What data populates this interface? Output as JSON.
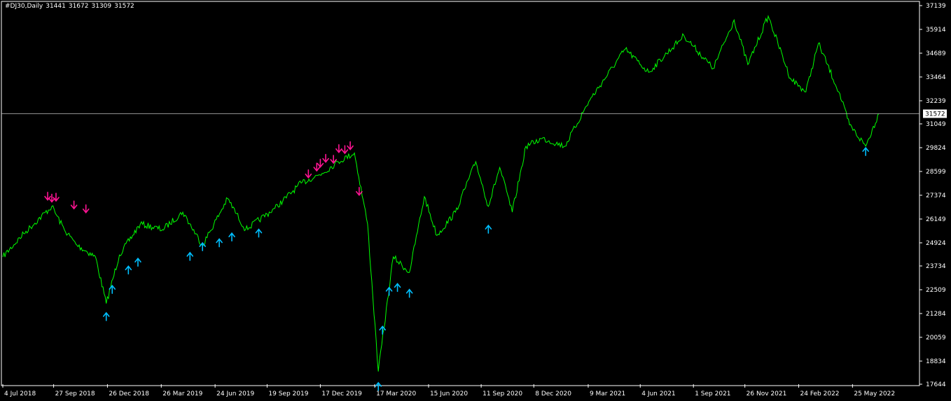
{
  "header": {
    "symbol": "#DJ30,Daily",
    "open": "31441",
    "high": "31672",
    "low": "31309",
    "close": "31572"
  },
  "colors": {
    "background": "#000000",
    "frame": "#ffffff",
    "price_line": "#00ff00",
    "sell_arrow": "#ff1493",
    "buy_arrow": "#00bfff",
    "current_price_line": "#c0c0c0"
  },
  "chart_data": {
    "type": "line",
    "title": "",
    "series": [
      {
        "name": "",
        "x": [
          "2018-07-04",
          "2018-08-08",
          "2018-09-24",
          "2018-10-15",
          "2018-11-05",
          "2018-12-06",
          "2018-12-24",
          "2019-01-15",
          "2019-02-19",
          "2019-03-28",
          "2019-05-01",
          "2019-06-03",
          "2019-07-15",
          "2019-08-14",
          "2019-10-02",
          "2019-11-15",
          "2019-12-20",
          "2020-01-16",
          "2020-02-12",
          "2020-03-05",
          "2020-03-23",
          "2020-04-17",
          "2020-05-14",
          "2020-06-08",
          "2020-06-29",
          "2020-07-30",
          "2020-09-02",
          "2020-09-23",
          "2020-10-12",
          "2020-11-02",
          "2020-11-25",
          "2020-12-22",
          "2021-01-29",
          "2021-03-10",
          "2021-05-10",
          "2021-06-18",
          "2021-08-16",
          "2021-10-04",
          "2021-11-08",
          "2021-12-01",
          "2022-01-04",
          "2022-02-10",
          "2022-03-08",
          "2022-03-29",
          "2022-05-02",
          "2022-05-20",
          "2022-06-16",
          "2022-07-08"
        ],
        "y": [
          24200,
          25400,
          26800,
          25600,
          24800,
          24200,
          21800,
          24300,
          25900,
          25600,
          26500,
          24800,
          27200,
          25600,
          26700,
          28000,
          28500,
          29100,
          29550,
          25900,
          18300,
          24200,
          23400,
          27300,
          25300,
          26500,
          29100,
          26800,
          28800,
          26500,
          29900,
          30300,
          29900,
          32200,
          34900,
          33700,
          35600,
          33900,
          36400,
          34100,
          36600,
          33400,
          32700,
          35200,
          32700,
          31000,
          29900,
          31572
        ]
      }
    ],
    "sell_signals": [
      {
        "date": "2018-09-17",
        "value": 26950
      },
      {
        "date": "2018-09-24",
        "value": 26850
      },
      {
        "date": "2018-10-01",
        "value": 26900
      },
      {
        "date": "2018-10-31",
        "value": 26500
      },
      {
        "date": "2018-11-20",
        "value": 26300
      },
      {
        "date": "2019-11-27",
        "value": 28100
      },
      {
        "date": "2019-12-11",
        "value": 28450
      },
      {
        "date": "2019-12-17",
        "value": 28650
      },
      {
        "date": "2019-12-26",
        "value": 28900
      },
      {
        "date": "2020-01-08",
        "value": 28850
      },
      {
        "date": "2020-01-17",
        "value": 29400
      },
      {
        "date": "2020-01-27",
        "value": 29350
      },
      {
        "date": "2020-02-05",
        "value": 29550
      },
      {
        "date": "2020-02-20",
        "value": 27200
      }
    ],
    "buy_signals": [
      {
        "date": "2018-12-24",
        "value": 21500
      },
      {
        "date": "2019-01-03",
        "value": 22900
      },
      {
        "date": "2019-01-30",
        "value": 23900
      },
      {
        "date": "2019-02-15",
        "value": 24300
      },
      {
        "date": "2019-05-13",
        "value": 24600
      },
      {
        "date": "2019-06-03",
        "value": 25100
      },
      {
        "date": "2019-07-01",
        "value": 25300
      },
      {
        "date": "2019-07-22",
        "value": 25600
      },
      {
        "date": "2019-09-05",
        "value": 25800
      },
      {
        "date": "2020-03-23",
        "value": 17900
      },
      {
        "date": "2020-03-30",
        "value": 20800
      },
      {
        "date": "2020-04-10",
        "value": 22800
      },
      {
        "date": "2020-04-24",
        "value": 23000
      },
      {
        "date": "2020-05-14",
        "value": 22700
      },
      {
        "date": "2020-09-23",
        "value": 26000
      },
      {
        "date": "2022-06-16",
        "value": 30000
      }
    ],
    "current_price": 31572,
    "x_ticks": [
      {
        "date": "2018-07-04",
        "label": "4 Jul 2018"
      },
      {
        "date": "2018-09-27",
        "label": "27 Sep 2018"
      },
      {
        "date": "2018-12-26",
        "label": "26 Dec 2018"
      },
      {
        "date": "2019-03-26",
        "label": "26 Mar 2019"
      },
      {
        "date": "2019-06-24",
        "label": "24 Jun 2019"
      },
      {
        "date": "2019-09-19",
        "label": "19 Sep 2019"
      },
      {
        "date": "2019-12-17",
        "label": "17 Dec 2019"
      },
      {
        "date": "2020-03-17",
        "label": "17 Mar 2020"
      },
      {
        "date": "2020-06-15",
        "label": "15 Jun 2020"
      },
      {
        "date": "2020-09-11",
        "label": "11 Sep 2020"
      },
      {
        "date": "2020-12-08",
        "label": "8 Dec 2020"
      },
      {
        "date": "2021-03-09",
        "label": "9 Mar 2021"
      },
      {
        "date": "2021-06-04",
        "label": "4 Jun 2021"
      },
      {
        "date": "2021-09-01",
        "label": "1 Sep 2021"
      },
      {
        "date": "2021-11-26",
        "label": "26 Nov 2021"
      },
      {
        "date": "2022-02-24",
        "label": "24 Feb 2022"
      },
      {
        "date": "2022-05-25",
        "label": "25 May 2022"
      }
    ],
    "y_ticks": [
      17644,
      18834,
      20059,
      21284,
      22509,
      23734,
      24924,
      26149,
      27374,
      28599,
      29824,
      31049,
      32239,
      33464,
      34689,
      35914,
      37139
    ],
    "xlim": [
      "2018-07-04",
      "2022-09-14"
    ],
    "ylim": [
      17644,
      37139
    ],
    "grid": false,
    "legend": "none"
  }
}
